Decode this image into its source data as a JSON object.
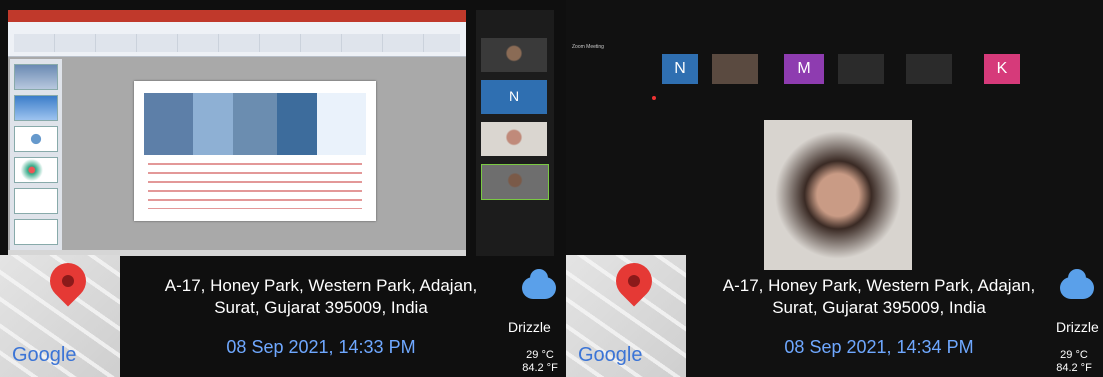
{
  "left": {
    "geotag": {
      "address_line1": "A-17, Honey Park, Western Park, Adajan,",
      "address_line2": "Surat, Gujarat 395009, India",
      "datetime": "08 Sep 2021, 14:33 PM",
      "weather": "Drizzle",
      "temp_c": "29 °C",
      "temp_f": "84.2 °F",
      "map_brand": "Google",
      "icons": [
        "map-pin-icon",
        "cloud-rain-icon"
      ]
    }
  },
  "right": {
    "zoom_title": "Zoom Meeting",
    "tiles": [
      {
        "letter": "N",
        "color": "#2f6fb1"
      },
      {
        "letter": "",
        "color": "#5a4a40"
      },
      {
        "letter": "M",
        "color": "#8e3cb0"
      },
      {
        "letter": "",
        "color": "#2b2b2b"
      },
      {
        "letter": "",
        "color": "#2b2b2b"
      },
      {
        "letter": "K",
        "color": "#d63a7a"
      }
    ],
    "geotag": {
      "address_line1": "A-17, Honey Park, Western Park, Adajan,",
      "address_line2": "Surat, Gujarat 395009, India",
      "datetime": "08 Sep 2021, 14:34 PM",
      "weather": "Drizzle",
      "temp_c": "29 °C",
      "temp_f": "84.2 °F",
      "map_brand": "Google"
    }
  }
}
